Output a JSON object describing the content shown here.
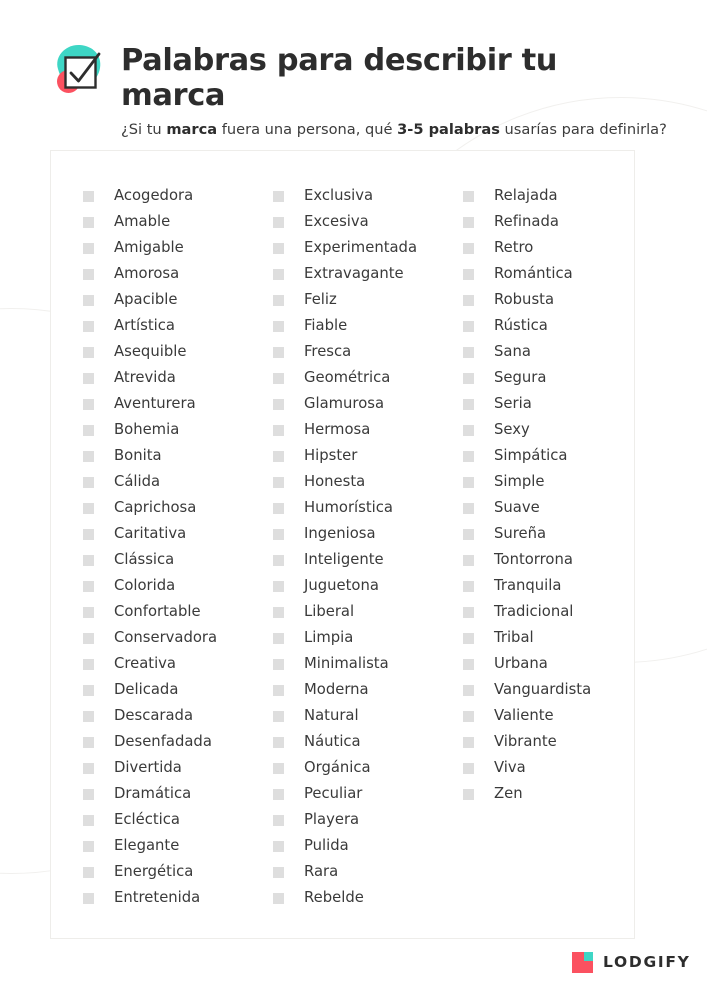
{
  "header": {
    "logo_icon": "checkbox-check-icon",
    "title": "Palabras para describir tu marca",
    "subtitle_parts": {
      "before": "¿Si tu ",
      "bold1": "marca",
      "middle": " fuera una persona, qué ",
      "bold2": "3-5 palabras",
      "after": " usarías para definirla?"
    }
  },
  "card": {
    "columns": [
      {
        "index": 1,
        "words": [
          "Acogedora",
          "Amable",
          "Amigable",
          "Amorosa",
          "Apacible",
          "Artística",
          "Asequible",
          "Atrevida",
          "Aventurera",
          "Bohemia",
          "Bonita",
          "Cálida",
          "Caprichosa",
          "Caritativa",
          "Clássica",
          "Colorida",
          "Confortable",
          "Conservadora",
          "Creativa",
          "Delicada",
          "Descarada",
          "Desenfadada",
          "Divertida",
          "Dramática",
          "Ecléctica",
          "Elegante",
          "Energética",
          "Entretenida"
        ]
      },
      {
        "index": 2,
        "words": [
          "Exclusiva",
          "Excesiva",
          "Experimentada",
          "Extravagante",
          "Feliz",
          "Fiable",
          "Fresca",
          "Geométrica",
          "Glamurosa",
          "Hermosa",
          "Hipster",
          "Honesta",
          "Humorística",
          "Ingeniosa",
          "Inteligente",
          "Juguetona",
          "Liberal",
          "Limpia",
          "Minimalista",
          "Moderna",
          "Natural",
          "Náutica",
          "Orgánica",
          "Peculiar",
          "Playera",
          "Pulida",
          "Rara",
          "Rebelde"
        ]
      },
      {
        "index": 3,
        "words": [
          "Relajada",
          "Refinada",
          "Retro",
          "Romántica",
          "Robusta",
          "Rústica",
          "Sana",
          "Segura",
          "Seria",
          "Sexy",
          "Simpática",
          "Simple",
          "Suave",
          "Sureña",
          "Tontorrona",
          "Tranquila",
          "Tradicional",
          "Tribal",
          "Urbana",
          "Vanguardista",
          "Valiente",
          "Vibrante",
          "Viva",
          "Zen"
        ]
      }
    ]
  },
  "footer": {
    "logo_icon": "lodgify-logo-icon",
    "wordmark": "LODGIFY"
  },
  "colors": {
    "text_dark": "#2d2d2d",
    "text_body": "#3a3a3a",
    "checkbox_gray": "#dedede",
    "card_border": "#eeedea",
    "brand_teal": "#3ed6c5",
    "brand_red": "#fb5160",
    "deco_line": "#f1f0ee"
  }
}
